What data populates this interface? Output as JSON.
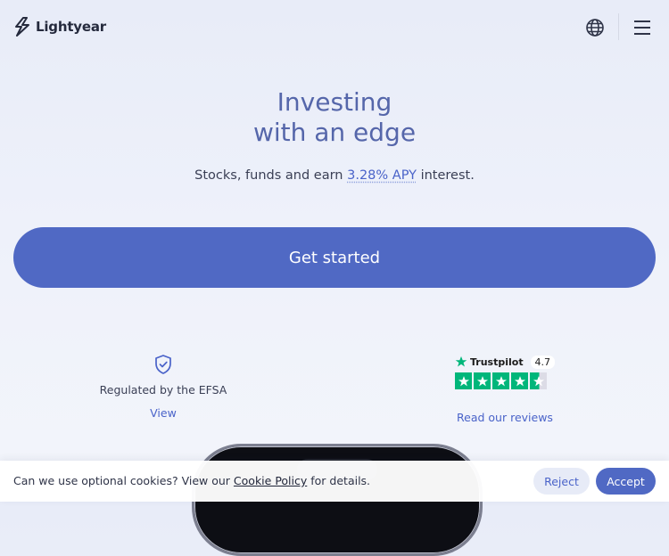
{
  "header": {
    "brand": "Lightyear",
    "logo_icon": "bolt-logo-icon",
    "globe_icon": "globe-icon",
    "menu_icon": "hamburger-menu-icon"
  },
  "hero": {
    "title_line1": "Investing",
    "title_line2": "with an edge",
    "subtitle_prefix": "Stocks, funds and earn ",
    "subtitle_rate": "3.28% APY",
    "subtitle_suffix": " interest.",
    "cta_label": "Get started"
  },
  "trust": {
    "efsa": {
      "icon": "shield-check-icon",
      "label": "Regulated by the EFSA",
      "link": "View"
    },
    "trustpilot": {
      "name": "Trustpilot",
      "score": "4.7",
      "stars": 4.5,
      "link": "Read our reviews"
    }
  },
  "cookie_banner": {
    "text_prefix": "Can we use optional cookies? View our ",
    "policy_link": "Cookie Policy",
    "text_suffix": " for details.",
    "reject_label": "Reject",
    "accept_label": "Accept"
  },
  "colors": {
    "accent": "#5069c4",
    "title": "#5566aa",
    "link": "#4a63c9",
    "trustpilot_green": "#00b67a"
  }
}
